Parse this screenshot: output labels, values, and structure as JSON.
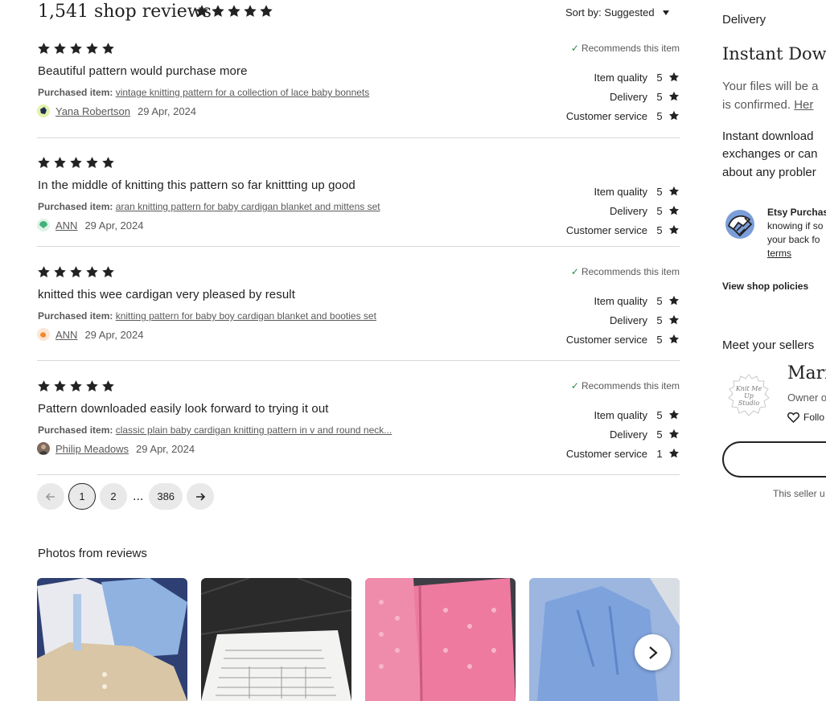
{
  "header": {
    "title": "1,541 shop reviews",
    "rating_stars": 5,
    "sort_label": "Sort by: Suggested"
  },
  "colors": {
    "text": "#222222",
    "muted": "#595959",
    "check_green": "#2d8a45",
    "divider": "#d8d8d8",
    "pill_bg": "#e9e9e9"
  },
  "reviews": [
    {
      "stars": 5,
      "recommends": "Recommends this item",
      "text": "Beautiful pattern would purchase more",
      "purchased_label": "Purchased item:",
      "item": "vintage knitting pattern for a collection of lace baby bonnets",
      "author": "Yana Robertson",
      "date": "29 Apr, 2024",
      "ratings": [
        {
          "label": "Item quality",
          "value": "5"
        },
        {
          "label": "Delivery",
          "value": "5"
        },
        {
          "label": "Customer service",
          "value": "5"
        }
      ]
    },
    {
      "stars": 5,
      "recommends": "",
      "text": "In the middle of knitting this pattern so far knittting up good",
      "purchased_label": "Purchased item:",
      "item": "aran knitting pattern for baby cardigan blanket and mittens set",
      "author": "ANN",
      "date": "29 Apr, 2024",
      "ratings": [
        {
          "label": "Item quality",
          "value": "5"
        },
        {
          "label": "Delivery",
          "value": "5"
        },
        {
          "label": "Customer service",
          "value": "5"
        }
      ]
    },
    {
      "stars": 5,
      "recommends": "Recommends this item",
      "text": "knitted this wee cardigan very pleased by result",
      "purchased_label": "Purchased item:",
      "item": "knitting pattern for baby boy cardigan blanket and booties set",
      "author": "ANN",
      "date": "29 Apr, 2024",
      "ratings": [
        {
          "label": "Item quality",
          "value": "5"
        },
        {
          "label": "Delivery",
          "value": "5"
        },
        {
          "label": "Customer service",
          "value": "5"
        }
      ]
    },
    {
      "stars": 5,
      "recommends": "Recommends this item",
      "text": "Pattern downloaded easily look forward to trying it out",
      "purchased_label": "Purchased item:",
      "item": "classic plain baby cardigan knitting pattern in v and round neck...",
      "author": "Philip Meadows",
      "date": "29 Apr, 2024",
      "ratings": [
        {
          "label": "Item quality",
          "value": "5"
        },
        {
          "label": "Delivery",
          "value": "5"
        },
        {
          "label": "Customer service",
          "value": "1"
        }
      ]
    }
  ],
  "pagination": {
    "prev_icon": "arrow-left-icon",
    "pages": [
      "1",
      "2",
      "386"
    ],
    "ellipsis": "...",
    "current": "1",
    "next_icon": "arrow-right-icon"
  },
  "photos": {
    "title": "Photos from reviews",
    "next_icon": "chevron-right-icon"
  },
  "sidebar": {
    "delivery_heading": "Delivery",
    "instant_title": "Instant Down",
    "files_line1": "Your files will be a",
    "files_line2": "is confirmed.",
    "files_link": "Her",
    "desc_lines": [
      "Instant download",
      "exchanges or can",
      "about any probler"
    ],
    "protection_title": "Etsy Purchas",
    "protection_lines": [
      "knowing if so",
      "your back fo"
    ],
    "protection_link": "terms",
    "view_policies": "View shop policies",
    "meet_heading": "Meet your sellers",
    "seller_name": "Mario",
    "seller_role": "Owner o",
    "follow_label": "Follo",
    "logo_text_lines": [
      "Knit Me",
      "Up",
      "Studio"
    ],
    "footer_note": "This seller u"
  }
}
